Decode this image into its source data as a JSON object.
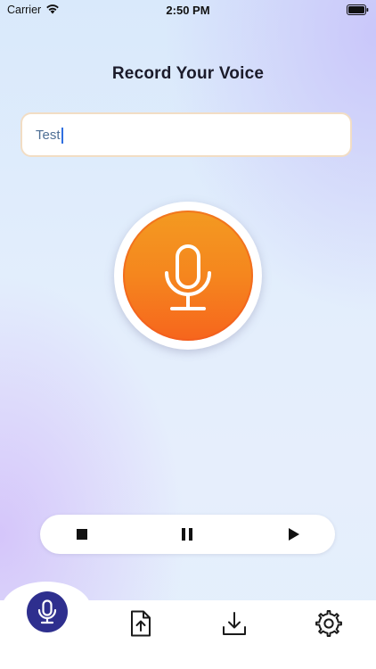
{
  "status_bar": {
    "carrier": "Carrier",
    "time": "2:50 PM",
    "wifi_icon": "wifi-icon",
    "battery_icon": "battery-full-icon"
  },
  "page": {
    "title": "Record Your Voice"
  },
  "name_input": {
    "value": "Test",
    "placeholder": ""
  },
  "record_button": {
    "icon": "microphone-icon",
    "colors": {
      "top": "#f39a21",
      "bottom": "#f6651d",
      "ring": "#ffffff"
    }
  },
  "player_controls": [
    {
      "name": "stop",
      "icon": "stop-icon"
    },
    {
      "name": "pause",
      "icon": "pause-icon"
    },
    {
      "name": "play",
      "icon": "play-icon"
    }
  ],
  "tab_bar": {
    "active_color": "#2e2f8e",
    "tabs": [
      {
        "name": "record",
        "icon": "microphone-icon",
        "active": true
      },
      {
        "name": "upload",
        "icon": "file-upload-icon",
        "active": false
      },
      {
        "name": "download",
        "icon": "download-icon",
        "active": false
      },
      {
        "name": "settings",
        "icon": "gear-icon",
        "active": false
      }
    ]
  }
}
